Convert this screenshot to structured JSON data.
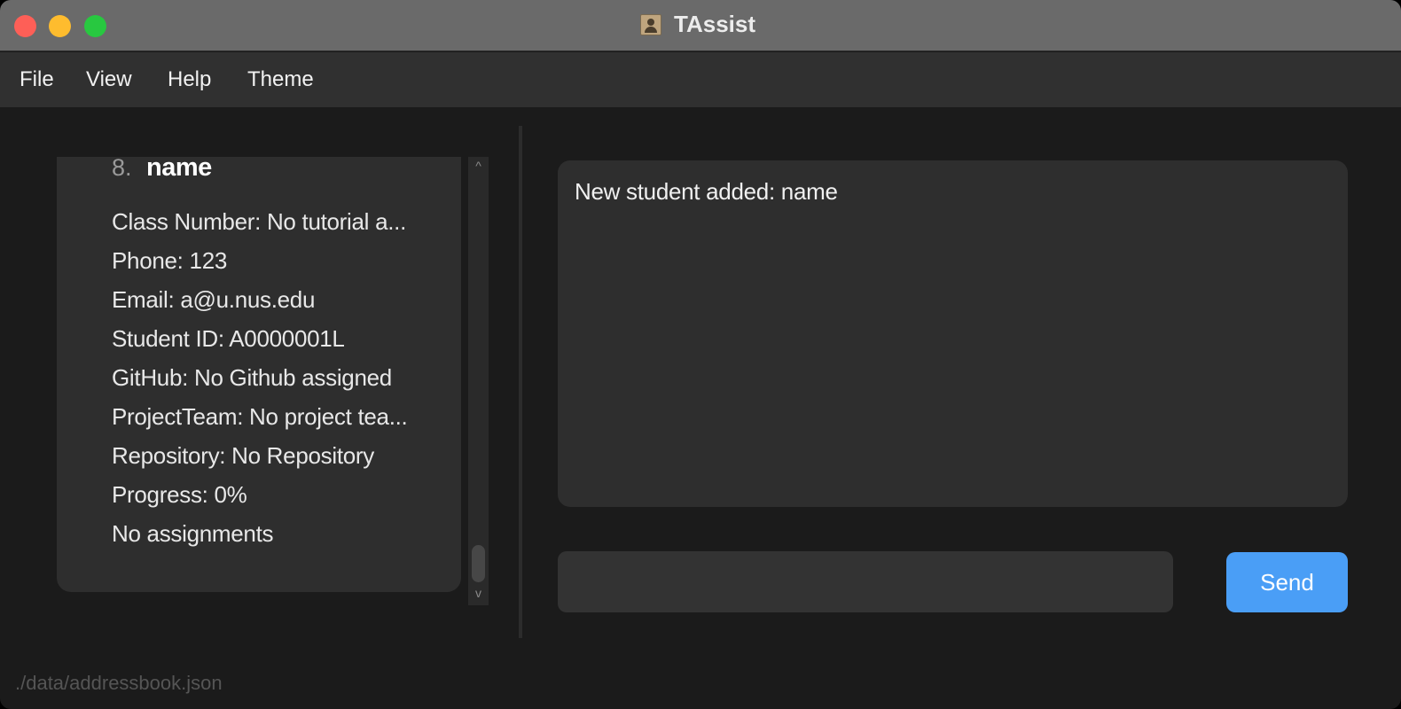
{
  "window": {
    "title": "TAssist"
  },
  "menu": [
    "File",
    "View",
    "Help",
    "Theme"
  ],
  "student_card": {
    "index": "8.",
    "name": "name",
    "fields": [
      "Class Number: No tutorial a...",
      "Phone: 123",
      "Email: a@u.nus.edu",
      "Student ID: A0000001L",
      "GitHub: No Github assigned",
      "ProjectTeam: No project tea...",
      "Repository: No Repository",
      "Progress: 0%",
      "No assignments"
    ]
  },
  "scrollbar": {
    "up_arrow": "^",
    "down_arrow": "v"
  },
  "result_display": {
    "text": "New student added: name"
  },
  "command_box": {
    "value": "",
    "placeholder": ""
  },
  "send_button": {
    "label": "Send"
  },
  "status_bar": {
    "path": "./data/addressbook.json"
  },
  "colors": {
    "accent": "#4a9ef6",
    "background": "#1b1b1b",
    "card": "#2e2e2e",
    "titlebar": "#6a6a6a"
  },
  "icons": [
    "close-window-icon",
    "minimize-window-icon",
    "maximize-window-icon",
    "app-contact-icon",
    "scroll-up-icon",
    "scroll-down-icon"
  ]
}
